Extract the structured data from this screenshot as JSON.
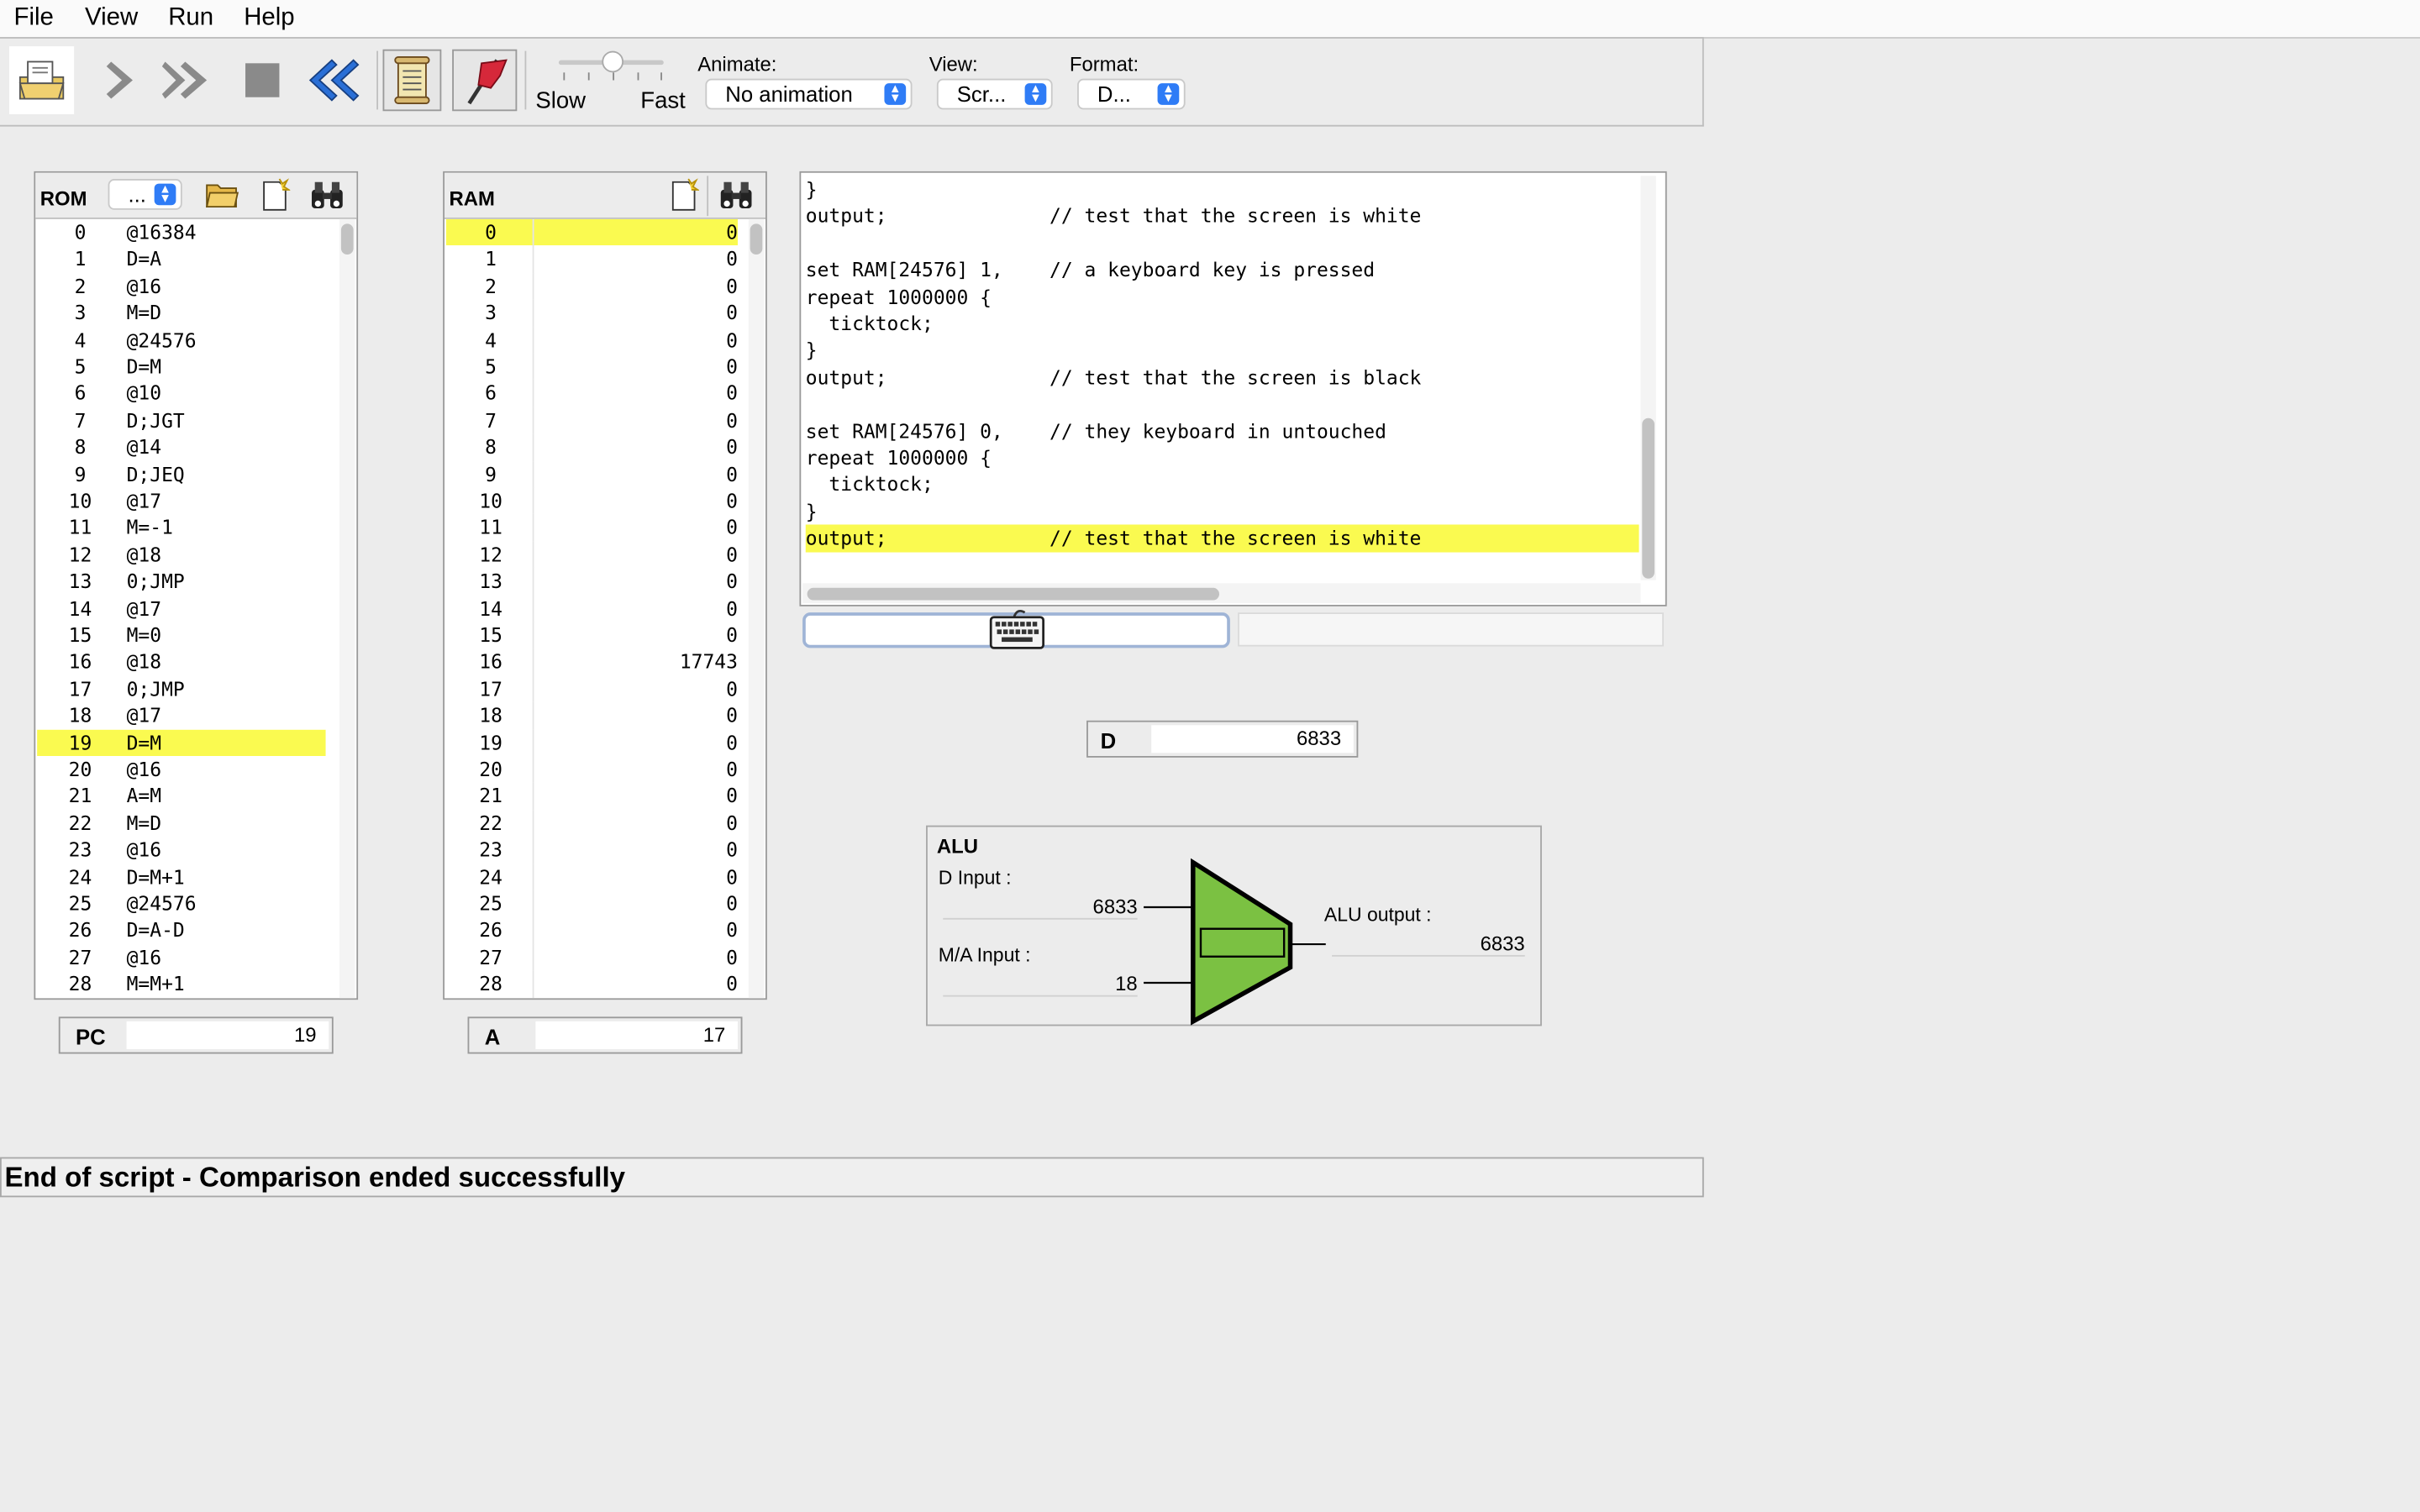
{
  "menu": [
    "File",
    "View",
    "Run",
    "Help"
  ],
  "toolbar": {
    "slider_slow": "Slow",
    "slider_fast": "Fast",
    "animate_label": "Animate:",
    "animate_value": "No animation",
    "view_label": "View:",
    "view_value": "Scr...",
    "format_label": "Format:",
    "format_value": "D..."
  },
  "rom": {
    "title": "ROM",
    "format_value": "...",
    "highlight_index": 19,
    "rows": [
      {
        "i": "0",
        "v": "@16384"
      },
      {
        "i": "1",
        "v": "D=A"
      },
      {
        "i": "2",
        "v": "@16"
      },
      {
        "i": "3",
        "v": "M=D"
      },
      {
        "i": "4",
        "v": "@24576"
      },
      {
        "i": "5",
        "v": "D=M"
      },
      {
        "i": "6",
        "v": "@10"
      },
      {
        "i": "7",
        "v": "D;JGT"
      },
      {
        "i": "8",
        "v": "@14"
      },
      {
        "i": "9",
        "v": "D;JEQ"
      },
      {
        "i": "10",
        "v": "@17"
      },
      {
        "i": "11",
        "v": "M=-1"
      },
      {
        "i": "12",
        "v": "@18"
      },
      {
        "i": "13",
        "v": "0;JMP"
      },
      {
        "i": "14",
        "v": "@17"
      },
      {
        "i": "15",
        "v": "M=0"
      },
      {
        "i": "16",
        "v": "@18"
      },
      {
        "i": "17",
        "v": "0;JMP"
      },
      {
        "i": "18",
        "v": "@17"
      },
      {
        "i": "19",
        "v": "D=M"
      },
      {
        "i": "20",
        "v": "@16"
      },
      {
        "i": "21",
        "v": "A=M"
      },
      {
        "i": "22",
        "v": "M=D"
      },
      {
        "i": "23",
        "v": "@16"
      },
      {
        "i": "24",
        "v": "D=M+1"
      },
      {
        "i": "25",
        "v": "@24576"
      },
      {
        "i": "26",
        "v": "D=A-D"
      },
      {
        "i": "27",
        "v": "@16"
      },
      {
        "i": "28",
        "v": "M=M+1"
      }
    ]
  },
  "ram": {
    "title": "RAM",
    "highlight_index": 0,
    "rows": [
      {
        "i": "0",
        "v": "0"
      },
      {
        "i": "1",
        "v": "0"
      },
      {
        "i": "2",
        "v": "0"
      },
      {
        "i": "3",
        "v": "0"
      },
      {
        "i": "4",
        "v": "0"
      },
      {
        "i": "5",
        "v": "0"
      },
      {
        "i": "6",
        "v": "0"
      },
      {
        "i": "7",
        "v": "0"
      },
      {
        "i": "8",
        "v": "0"
      },
      {
        "i": "9",
        "v": "0"
      },
      {
        "i": "10",
        "v": "0"
      },
      {
        "i": "11",
        "v": "0"
      },
      {
        "i": "12",
        "v": "0"
      },
      {
        "i": "13",
        "v": "0"
      },
      {
        "i": "14",
        "v": "0"
      },
      {
        "i": "15",
        "v": "0"
      },
      {
        "i": "16",
        "v": "17743"
      },
      {
        "i": "17",
        "v": "0"
      },
      {
        "i": "18",
        "v": "0"
      },
      {
        "i": "19",
        "v": "0"
      },
      {
        "i": "20",
        "v": "0"
      },
      {
        "i": "21",
        "v": "0"
      },
      {
        "i": "22",
        "v": "0"
      },
      {
        "i": "23",
        "v": "0"
      },
      {
        "i": "24",
        "v": "0"
      },
      {
        "i": "25",
        "v": "0"
      },
      {
        "i": "26",
        "v": "0"
      },
      {
        "i": "27",
        "v": "0"
      },
      {
        "i": "28",
        "v": "0"
      }
    ]
  },
  "script": {
    "highlight_index": 13,
    "lines": [
      "}",
      "output;              // test that the screen is white",
      "",
      "set RAM[24576] 1,    // a keyboard key is pressed",
      "repeat 1000000 {",
      "  ticktock;",
      "}",
      "output;              // test that the screen is black",
      "",
      "set RAM[24576] 0,    // they keyboard in untouched",
      "repeat 1000000 {",
      "  ticktock;",
      "}",
      "output;              // test that the screen is white"
    ]
  },
  "registers": {
    "pc_label": "PC",
    "pc_value": "19",
    "a_label": "A",
    "a_value": "17",
    "d_label": "D",
    "d_value": "6833"
  },
  "alu": {
    "title": "ALU",
    "d_input_label": "D Input :",
    "d_input_value": "6833",
    "ma_input_label": "M/A Input :",
    "ma_input_value": "18",
    "output_label": "ALU output :",
    "output_value": "6833"
  },
  "status": "End of script - Comparison ended successfully",
  "colors": {
    "highlight": "#fafa50",
    "alu_fill": "#7bc142",
    "accent": "#2f7cf6"
  }
}
